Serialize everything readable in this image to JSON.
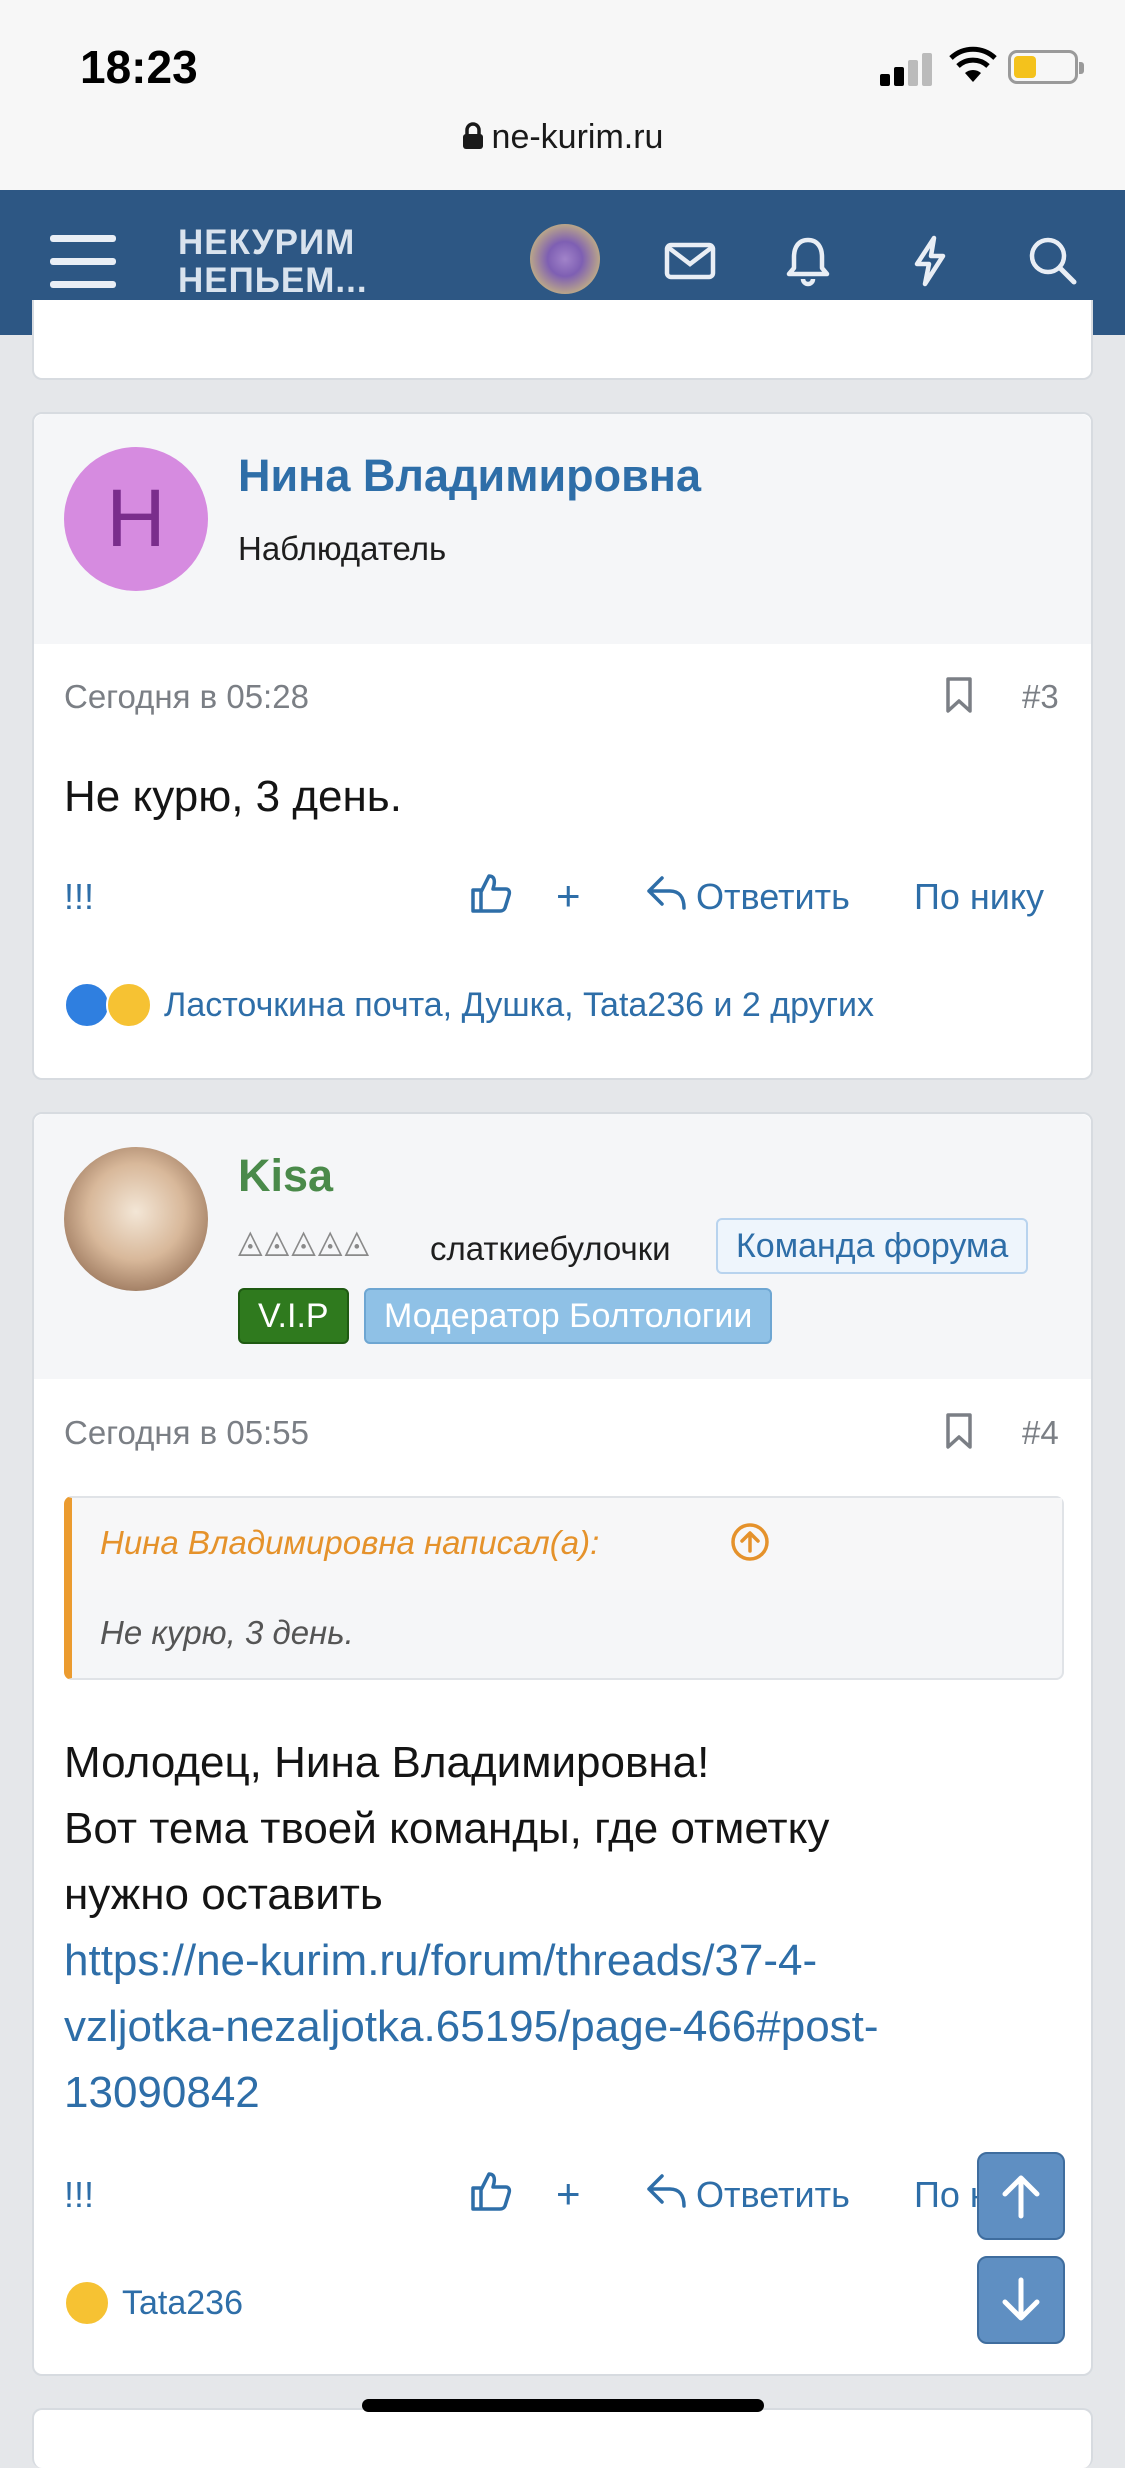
{
  "status": {
    "time": "18:23"
  },
  "browser": {
    "url": "ne-kurim.ru"
  },
  "header": {
    "logo_line1": "НЕКУРИМ",
    "logo_line2": "НЕПЬЕМ...",
    "icons": [
      "menu-icon",
      "avatar",
      "mail-icon",
      "bell-icon",
      "lightning-icon",
      "search-icon"
    ]
  },
  "posts": [
    {
      "author": "Нина Владимировна",
      "avatar_letter": "Н",
      "user_title": "Наблюдатель",
      "date": "Сегодня в 05:28",
      "number": "#3",
      "text": "Не курю, 3 день.",
      "actions": {
        "marks": "!!!",
        "plus": "+",
        "reply": "Ответить",
        "by_nick": "По нику"
      },
      "reactions": "Ласточкина почта, Душка, Tata236 и 2 других"
    },
    {
      "author": "Kisa",
      "user_title": "слаткиебулочки",
      "badges": {
        "team": "Команда форума",
        "vip": "V.I.P",
        "moderator": "Модератор Болтологии"
      },
      "date": "Сегодня в 05:55",
      "number": "#4",
      "quote": {
        "author": "Нина Владимировна написал(а):",
        "text": "Не курю, 3 день."
      },
      "text_lines": [
        "Молодец, Нина Владимировна!",
        "Вот тема твоей команды, где отметку",
        "нужно оставить"
      ],
      "link_lines": [
        "https://ne-kurim.ru/forum/threads/37-4-",
        "vzljotka-nezaljotka.65195/page-466#post-",
        "13090842"
      ],
      "actions": {
        "marks": "!!!",
        "plus": "+",
        "reply": "Ответить",
        "by_nick": "По нику"
      },
      "reactions": "Tata236"
    }
  ],
  "colors": {
    "navbar": "#2d5784",
    "link": "#2e6ea8",
    "username2": "#4a8a4a",
    "quote_border": "#eb9b2f"
  }
}
